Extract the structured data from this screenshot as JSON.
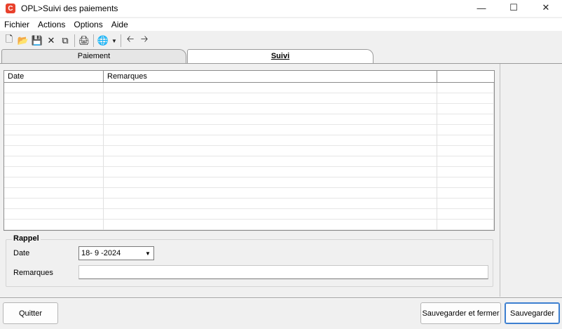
{
  "window": {
    "title": "OPL>Suivi des paiements",
    "app_icon_glyph": "C",
    "accent": "#e8412c"
  },
  "menu": [
    "Fichier",
    "Actions",
    "Options",
    "Aide"
  ],
  "toolbar": {
    "new": "new-document-icon",
    "open": "open-folder-icon",
    "save": "save-icon",
    "delete": "delete-icon",
    "copy": "copy-icon",
    "print": "print-icon",
    "web": "globe-icon",
    "back": "back-arrow-icon",
    "forward": "forward-arrow-icon"
  },
  "tabs": [
    {
      "label": "Paiement",
      "active": false
    },
    {
      "label": "Suivi",
      "active": true
    }
  ],
  "grid": {
    "columns": [
      "Date",
      "Remarques",
      ""
    ],
    "rows": []
  },
  "rappel": {
    "legend": "Rappel",
    "date_label": "Date",
    "date_value": "18- 9 -2024",
    "remarks_label": "Remarques",
    "remarks_value": ""
  },
  "buttons": {
    "quitter": "Quitter",
    "save_close": "Sauvegarder et fermer",
    "save": "Sauvegarder"
  }
}
